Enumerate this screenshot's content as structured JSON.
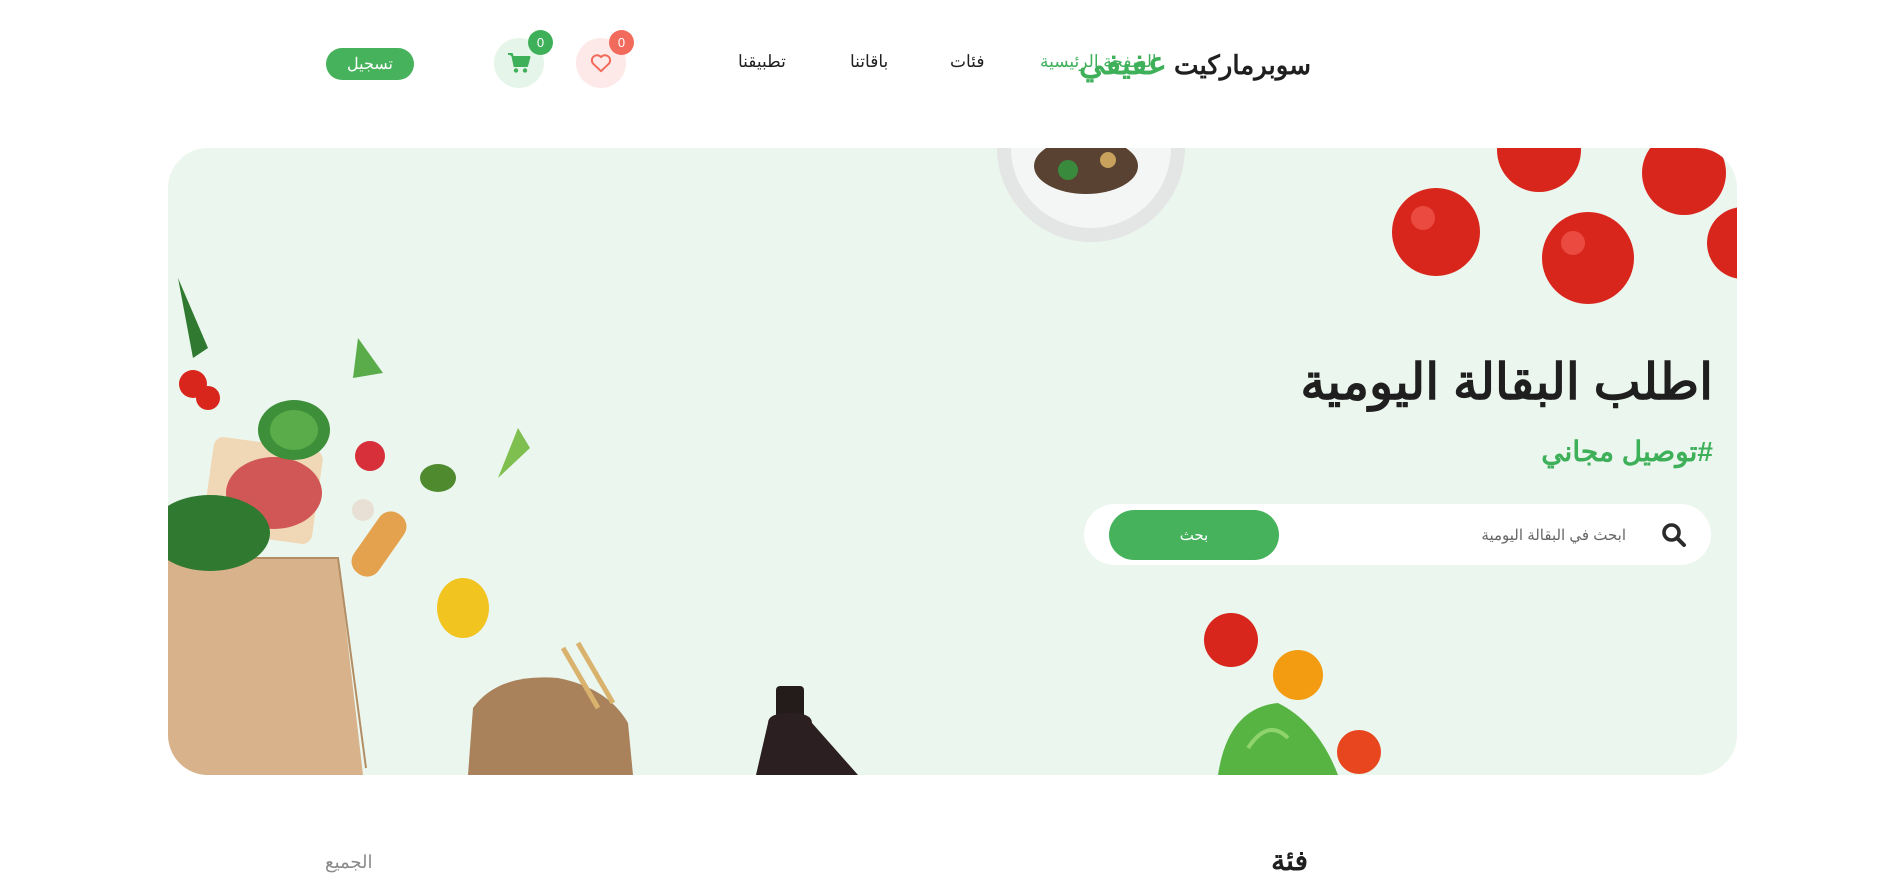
{
  "header": {
    "logo_text": "سوبرماركيت",
    "logo_accent": "عفيفي",
    "nav": [
      {
        "label": "الصفحة الرئيسية",
        "active": true
      },
      {
        "label": "فئات",
        "active": false
      },
      {
        "label": "باقاتنا",
        "active": false
      },
      {
        "label": "تطبيقنا",
        "active": false
      }
    ],
    "wishlist_count": "0",
    "cart_count": "0",
    "login_label": "تسجيل",
    "icons": {
      "wishlist": "heart-icon",
      "cart": "cart-icon",
      "search": "search-icon"
    }
  },
  "hero": {
    "title": "اطلب البقالة اليومية",
    "tagline": "#توصيل مجاني",
    "search_placeholder": "ابحث في البقالة اليومية",
    "search_button": "بحث"
  },
  "category": {
    "title": "فئة",
    "all_label": "الجميع"
  },
  "colors": {
    "accent": "#3fb05a",
    "hero_bg": "#ebf6ee",
    "wishlist_badge": "#f26a5b",
    "wishlist_bg": "#fde9e7",
    "cart_badge": "#3fb05a",
    "cart_bg": "#e6f5e9"
  }
}
